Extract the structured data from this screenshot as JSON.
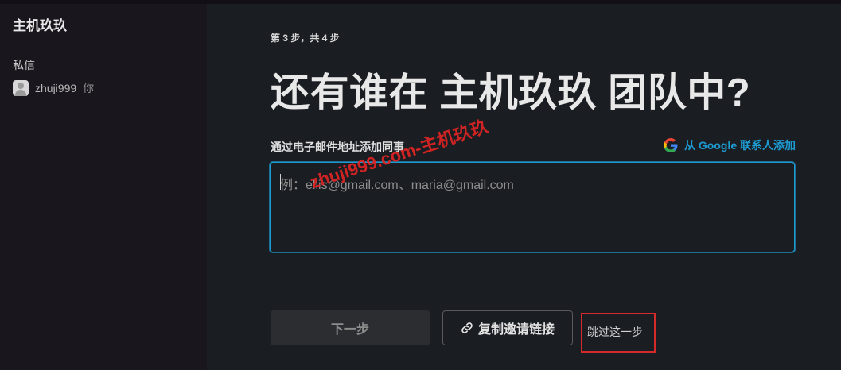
{
  "sidebar": {
    "workspace_name": "主机玖玖",
    "section_title": "私信",
    "dm_items": [
      {
        "name": "zhuji999",
        "suffix": "你",
        "icon": "user-avatar-icon"
      }
    ]
  },
  "main": {
    "step_text": "第 3 步，共 4 步",
    "title": "还有谁在 主机玖玖 团队中?",
    "field_label": "通过电子邮件地址添加同事",
    "google_link": {
      "label": "从 Google 联系人添加",
      "icon": "google-g-icon"
    },
    "email_input": {
      "placeholder": "例：ellis@gmail.com、maria@gmail.com",
      "value": ""
    },
    "watermark": "zhuji999.com-主机玖玖",
    "buttons": {
      "next_label": "下一步",
      "copy_label": "复制邀请链接",
      "copy_icon": "link-icon",
      "skip_label": "跳过这一步"
    }
  },
  "colors": {
    "accent": "#1d9bd1",
    "highlight_box": "#d42a2a",
    "watermark": "#e02424"
  }
}
